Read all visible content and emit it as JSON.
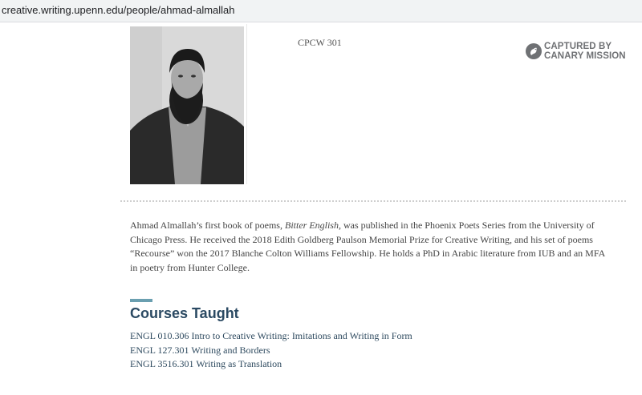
{
  "browser": {
    "url": "creative.writing.upenn.edu/people/ahmad-almallah"
  },
  "profile": {
    "photo_alt": "Ahmad Almallah",
    "course_code": "CPCW 301"
  },
  "stamp": {
    "line1": "CAPTURED BY",
    "line2": "CANARY MISSION",
    "color": "#6f7174"
  },
  "bio": {
    "part1": "Ahmad Almallah’s first book of poems, ",
    "book_title": "Bitter English",
    "part2": ", was published in the Phoenix Poets Series from the University of Chicago Press. He received the 2018 Edith Goldberg Paulson Memorial Prize for Creative Writing, and his set of poems “Recourse” won the 2017 Blanche Colton Williams Fellowship. He holds a PhD in Arabic literature from IUB and an MFA in poetry from Hunter College."
  },
  "courses": {
    "heading": "Courses Taught",
    "accent_color": "#6a9fb0",
    "items": [
      "ENGL 010.306 Intro to Creative Writing: Imitations and Writing in Form",
      "ENGL 127.301 Writing and Borders",
      "ENGL 3516.301 Writing as Translation"
    ]
  }
}
